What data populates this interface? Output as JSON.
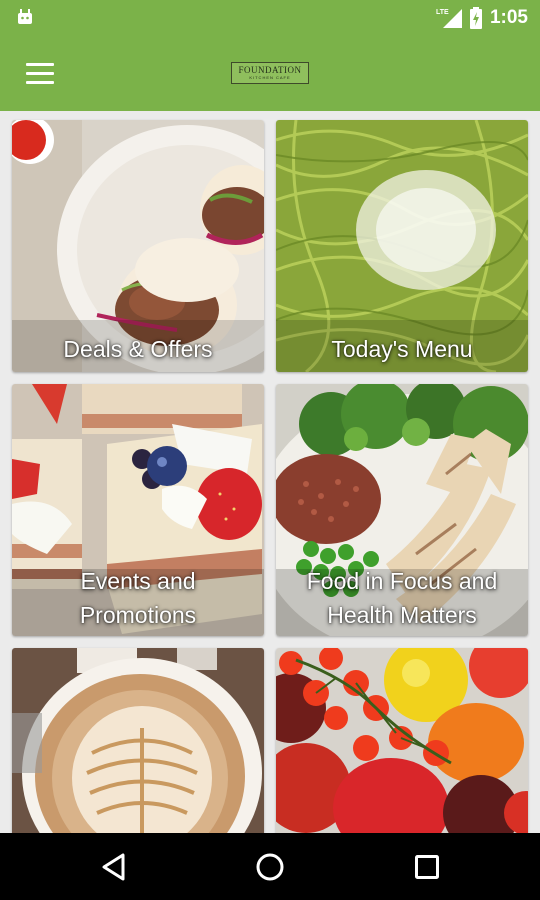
{
  "status_bar": {
    "time": "1:05",
    "network": "LTE",
    "icons": [
      "android-icon",
      "lte-signal-icon",
      "battery-charging-icon"
    ]
  },
  "app_bar": {
    "logo": {
      "name": "FOUNDATION",
      "tagline": "KITCHEN CAFE"
    },
    "menu_icon": "hamburger-menu-icon"
  },
  "tiles": [
    {
      "label": "Deals & Offers",
      "image": "bao-buns-photo"
    },
    {
      "label": "Today's Menu",
      "image": "pesto-pasta-photo"
    },
    {
      "label_line1": "Events and",
      "label_line2": "Promotions",
      "image": "dessert-cake-photo"
    },
    {
      "label_line1": "Food in Focus and",
      "label_line2": "Health Matters",
      "image": "quinoa-salad-photo"
    },
    {
      "image": "latte-art-photo"
    },
    {
      "image": "tomatoes-photo"
    }
  ],
  "nav_bar": {
    "icons": [
      "back-icon",
      "home-icon",
      "recents-icon"
    ]
  },
  "colors": {
    "app_bar": "#7bb249",
    "background": "#ebebeb",
    "nav_bar": "#000000"
  }
}
